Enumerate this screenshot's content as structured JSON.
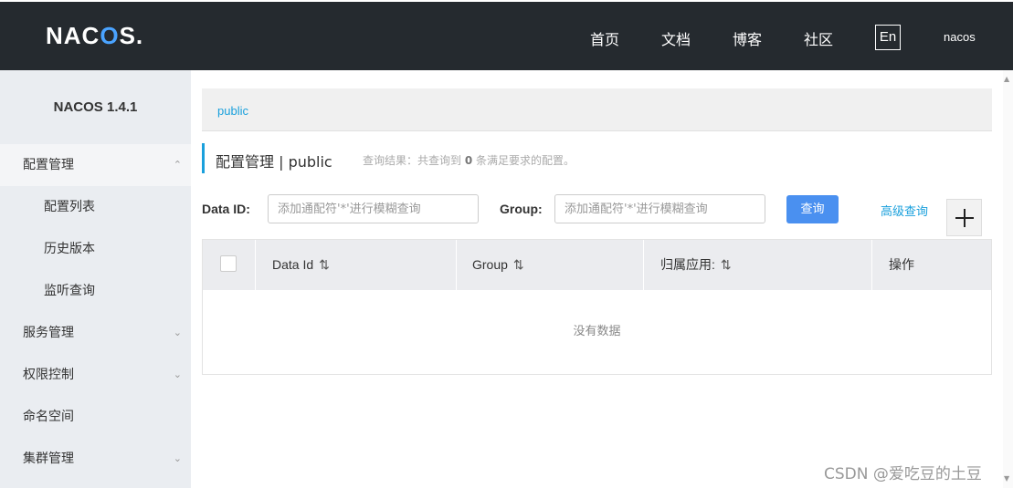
{
  "header": {
    "logo": "NACOS.",
    "nav": [
      "首页",
      "文档",
      "博客",
      "社区"
    ],
    "lang": "En",
    "user": "nacos"
  },
  "sidebar": {
    "title": "NACOS 1.4.1",
    "items": [
      {
        "label": "配置管理",
        "arrow": "^"
      },
      {
        "label": "配置列表"
      },
      {
        "label": "历史版本"
      },
      {
        "label": "监听查询"
      },
      {
        "label": "服务管理",
        "arrow": "v"
      },
      {
        "label": "权限控制",
        "arrow": "v"
      },
      {
        "label": "命名空间"
      },
      {
        "label": "集群管理",
        "arrow": "v"
      }
    ]
  },
  "main": {
    "breadcrumb": "public",
    "title": "配置管理 | public",
    "query_result_prefix": "查询结果：共查询到 ",
    "query_result_count": "0",
    "query_result_suffix": " 条满足要求的配置。",
    "dataid_label": "Data ID:",
    "dataid_placeholder": "添加通配符'*'进行模糊查询",
    "group_label": "Group:",
    "group_placeholder": "添加通配符'*'进行模糊查询",
    "query_button": "查询",
    "advanced_query": "高级查询",
    "add_icon": "plus-icon"
  },
  "table": {
    "columns": [
      "Data Id",
      "Group",
      "归属应用:",
      "操作"
    ],
    "sort_icon": "⇅",
    "empty_text": "没有数据"
  },
  "watermark": "CSDN @爱吃豆的土豆"
}
